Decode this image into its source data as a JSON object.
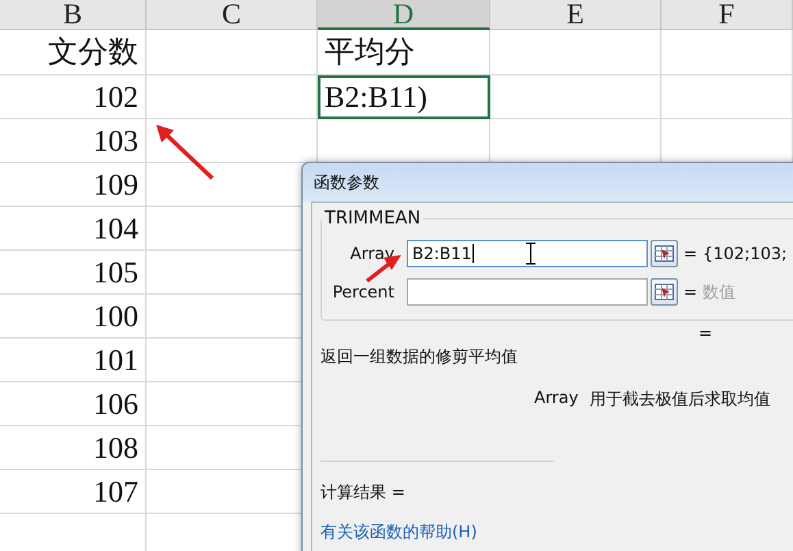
{
  "columns": [
    {
      "label": "B",
      "selected": false
    },
    {
      "label": "C",
      "selected": false
    },
    {
      "label": "D",
      "selected": true
    },
    {
      "label": "E",
      "selected": false
    },
    {
      "label": "F",
      "selected": false
    }
  ],
  "rows": [
    {
      "b": "文分数",
      "d": "平均分",
      "d_selected": false
    },
    {
      "b": "102",
      "d": "B2:B11)",
      "d_selected": true
    },
    {
      "b": "103"
    },
    {
      "b": "109"
    },
    {
      "b": "104"
    },
    {
      "b": "105"
    },
    {
      "b": "100"
    },
    {
      "b": "101"
    },
    {
      "b": "106"
    },
    {
      "b": "108"
    },
    {
      "b": "107"
    },
    {
      "b": ""
    }
  ],
  "dialog": {
    "title": "函数参数",
    "function_name": "TRIMMEAN",
    "arguments": [
      {
        "label": "Array",
        "value": "B2:B11",
        "equals": "=",
        "result": "{102;103;",
        "focused": true
      },
      {
        "label": "Percent",
        "equals": "=",
        "result_hint": "数值",
        "focused": false
      }
    ],
    "formula_result": "=",
    "description": "返回一组数据的修剪平均值",
    "argument_help": {
      "name": "Array",
      "text": "用于截去极值后求取均值"
    },
    "calc_result": "计算结果 =",
    "help_link": "有关该函数的帮助(H)"
  }
}
